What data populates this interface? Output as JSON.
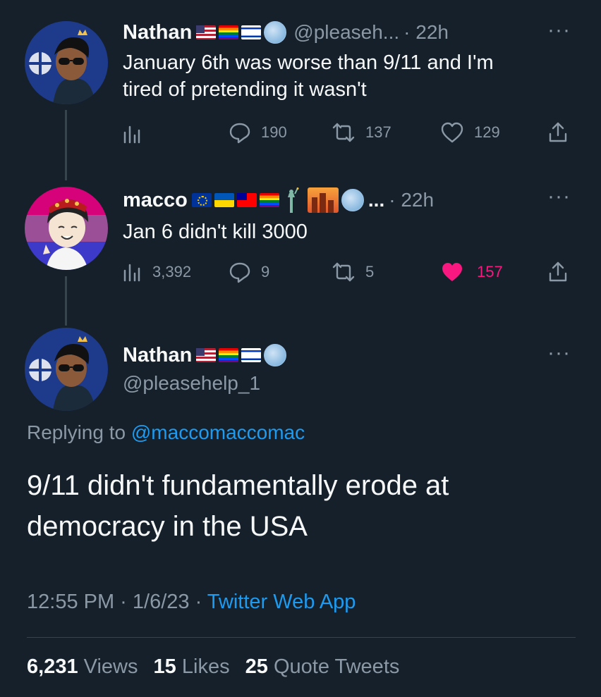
{
  "tweet1": {
    "name": "Nathan",
    "handle": "@pleaseh...",
    "time": "· 22h",
    "text_line1": "January 6th was worse than 9/11 and I'm",
    "text_line2": "tired of pretending it wasn't",
    "replies": "190",
    "retweets": "137",
    "likes": "129",
    "more": "···"
  },
  "tweet2": {
    "name": "macco",
    "handle": "...",
    "time": "· 22h",
    "text": "Jan 6 didn't kill 3000",
    "views": "3,392",
    "replies": "9",
    "retweets": "5",
    "likes": "157",
    "more": "···"
  },
  "main": {
    "name": "Nathan",
    "handle": "@pleasehelp_1",
    "more": "···",
    "replying_prefix": "Replying to",
    "replying_handle": "@maccomaccomac",
    "text_line1": "9/11 didn't fundamentally erode at",
    "text_line2": "democracy in the USA",
    "timestamp": "12:55 PM · 1/6/23 ·",
    "source": "Twitter Web App",
    "views_count": "6,231",
    "views_label": "Views",
    "likes_count": "15",
    "likes_label": "Likes",
    "quotes_count": "25",
    "quotes_label": "Quote Tweets"
  },
  "colors": {
    "background": "#15202b",
    "muted": "#8b98a5",
    "link": "#1d9bf0",
    "like_active": "#f91880"
  },
  "icons": [
    "analytics-icon",
    "reply-icon",
    "retweet-icon",
    "like-icon",
    "share-icon",
    "globe-icon",
    "flag-icons"
  ]
}
